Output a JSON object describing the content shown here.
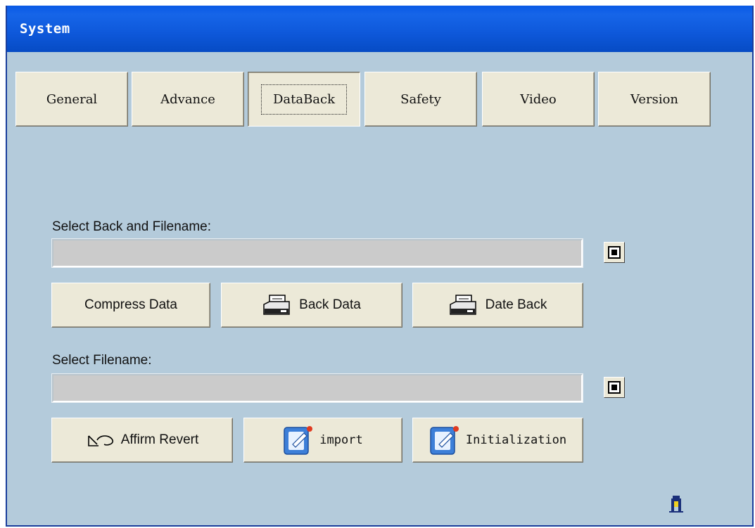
{
  "window": {
    "title": "System"
  },
  "tabs": [
    {
      "label": "General",
      "active": false
    },
    {
      "label": "Advance",
      "active": false
    },
    {
      "label": "DataBack",
      "active": true
    },
    {
      "label": "Safety",
      "active": false
    },
    {
      "label": "Video",
      "active": false
    },
    {
      "label": "Version",
      "active": false
    }
  ],
  "backup": {
    "label": "Select Back and Filename:",
    "path_value": "",
    "browse_icon": "browse-icon",
    "buttons": {
      "compress": "Compress Data",
      "back_data": "Back Data",
      "date_back": "Date Back"
    }
  },
  "restore": {
    "label": "Select Filename:",
    "path_value": "",
    "browse_icon": "browse-icon",
    "buttons": {
      "affirm_revert": "Affirm Revert",
      "import": "import",
      "initialization": "Initialization"
    }
  },
  "icons": {
    "drive": "drive-icon",
    "revert": "revert-arrow-icon",
    "app": "app-document-icon",
    "exit": "exit-door-icon"
  },
  "colors": {
    "titlebar": "#0a5ae6",
    "window_bg": "#b4cbdb",
    "button_face": "#ece9d8",
    "field_bg": "#cbcbcb"
  }
}
